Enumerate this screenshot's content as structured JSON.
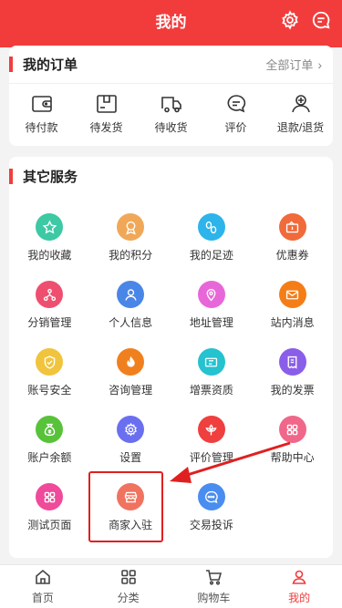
{
  "header": {
    "title": "我的",
    "gear_icon": "gear-icon",
    "chat_icon": "chat-icon"
  },
  "orders": {
    "title": "我的订单",
    "all_orders": "全部订单",
    "items": [
      {
        "label": "待付款",
        "icon": "wallet-icon"
      },
      {
        "label": "待发货",
        "icon": "package-icon"
      },
      {
        "label": "待收货",
        "icon": "truck-icon"
      },
      {
        "label": "评价",
        "icon": "comment-icon"
      },
      {
        "label": "退款/退货",
        "icon": "refund-icon"
      }
    ]
  },
  "services": {
    "title": "其它服务",
    "items": [
      {
        "label": "我的收藏",
        "icon": "star-icon",
        "color": "#3cc9a4"
      },
      {
        "label": "我的积分",
        "icon": "medal-icon",
        "color": "#f0a858"
      },
      {
        "label": "我的足迹",
        "icon": "footprint-icon",
        "color": "#2db4ea"
      },
      {
        "label": "优惠券",
        "icon": "coupon-icon",
        "color": "#f06a3a"
      },
      {
        "label": "分销管理",
        "icon": "distribution-icon",
        "color": "#ef4f6f"
      },
      {
        "label": "个人信息",
        "icon": "user-icon",
        "color": "#4a86e8"
      },
      {
        "label": "地址管理",
        "icon": "location-icon",
        "color": "#e867d8"
      },
      {
        "label": "站内消息",
        "icon": "mail-icon",
        "color": "#f57d17"
      },
      {
        "label": "账号安全",
        "icon": "shield-icon",
        "color": "#f0c43c"
      },
      {
        "label": "咨询管理",
        "icon": "flame-icon",
        "color": "#f0801e"
      },
      {
        "label": "增票资质",
        "icon": "ticket-icon",
        "color": "#25c2cf"
      },
      {
        "label": "我的发票",
        "icon": "invoice-icon",
        "color": "#8a5ee8"
      },
      {
        "label": "账户余额",
        "icon": "moneybag-icon",
        "color": "#58c23a"
      },
      {
        "label": "设置",
        "icon": "settings-icon",
        "color": "#6a6ff0"
      },
      {
        "label": "评价管理",
        "icon": "flower-icon",
        "color": "#ef3f3f"
      },
      {
        "label": "帮助中心",
        "icon": "grid-icon",
        "color": "#f0678a"
      },
      {
        "label": "测试页面",
        "icon": "apps-icon",
        "color": "#f04a9a"
      },
      {
        "label": "商家入驻",
        "icon": "store-icon",
        "color": "#f0735f"
      },
      {
        "label": "交易投诉",
        "icon": "complaint-icon",
        "color": "#4a8df0"
      }
    ]
  },
  "tabbar": {
    "items": [
      {
        "label": "首页",
        "icon": "home-icon",
        "active": false
      },
      {
        "label": "分类",
        "icon": "category-icon",
        "active": false
      },
      {
        "label": "购物车",
        "icon": "cart-icon",
        "active": false
      },
      {
        "label": "我的",
        "icon": "profile-icon",
        "active": true
      }
    ]
  },
  "colors": {
    "brand": "#f23c3c",
    "annotation": "#e02020"
  }
}
